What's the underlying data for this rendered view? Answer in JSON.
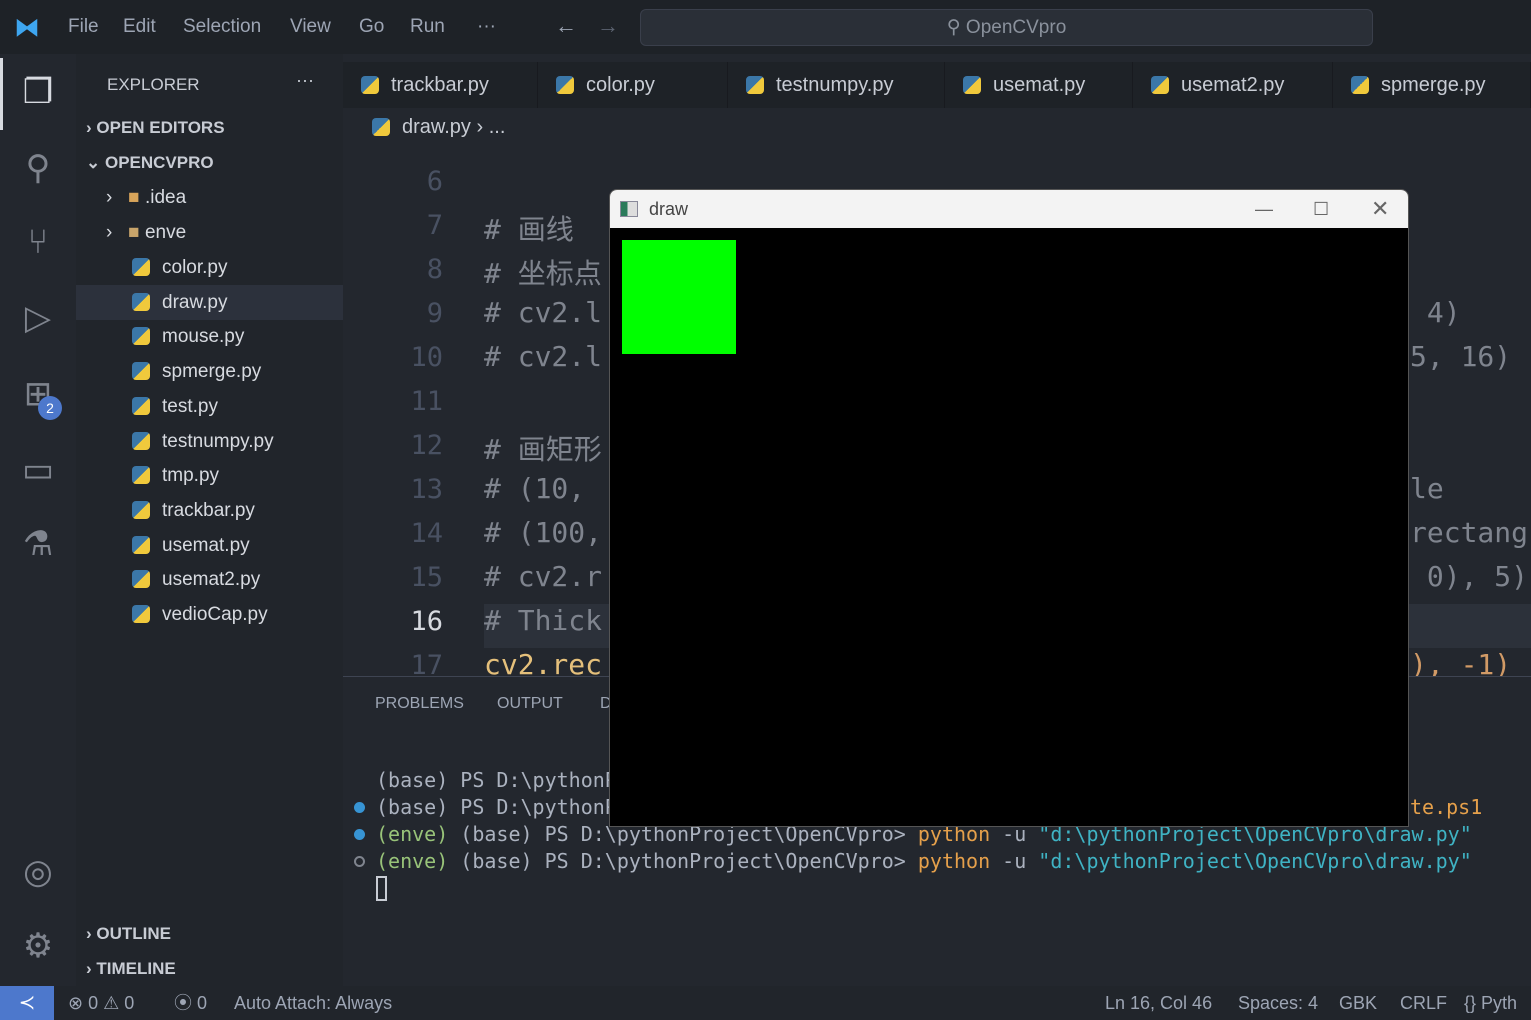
{
  "titlebar": {
    "menu": [
      "File",
      "Edit",
      "Selection",
      "View",
      "Go",
      "Run",
      "···"
    ],
    "search": "OpenCVpro"
  },
  "activity": {
    "extensions_badge": "2"
  },
  "sidebar": {
    "header": "EXPLORER",
    "more": "···",
    "open_editors": "OPEN EDITORS",
    "project": "OPENCVPRO",
    "folders": [
      ".idea",
      "enve"
    ],
    "files": [
      "color.py",
      "draw.py",
      "mouse.py",
      "spmerge.py",
      "test.py",
      "testnumpy.py",
      "tmp.py",
      "trackbar.py",
      "usemat.py",
      "usemat2.py",
      "vedioCap.py"
    ],
    "selected": "draw.py",
    "outline": "OUTLINE",
    "timeline": "TIMELINE"
  },
  "tabs": [
    "trackbar.py",
    "color.py",
    "testnumpy.py",
    "usemat.py",
    "usemat2.py",
    "spmerge.py"
  ],
  "breadcrumb": {
    "file": "draw.py",
    "rest": "..."
  },
  "editor": {
    "lines": [
      {
        "n": "6",
        "left": "",
        "right": ""
      },
      {
        "n": "7",
        "left": "# 画线",
        "right": ""
      },
      {
        "n": "8",
        "left": "# 坐标点",
        "right": ""
      },
      {
        "n": "9",
        "left": "# cv2.l",
        "right": " 4)"
      },
      {
        "n": "10",
        "left": "# cv2.l",
        "right": "5, 16)"
      },
      {
        "n": "11",
        "left": "",
        "right": ""
      },
      {
        "n": "12",
        "left": "# 画矩形",
        "right": ""
      },
      {
        "n": "13",
        "left": "# (10,",
        "right": "le"
      },
      {
        "n": "14",
        "left": "# (100,",
        "right": "rectang"
      },
      {
        "n": "15",
        "left": "# cv2.r",
        "right": " 0), 5)"
      },
      {
        "n": "16",
        "left": "# Thick",
        "right": ""
      },
      {
        "n": "17",
        "left": "cv2.rec",
        "right": "), -1)"
      }
    ],
    "current_line": "16"
  },
  "panel": {
    "tabs": [
      "PROBLEMS",
      "OUTPUT",
      "D"
    ],
    "terminal": [
      {
        "prefix": "",
        "text": "(base) PS D:\\pythonP",
        "tail": ""
      },
      {
        "prefix": "",
        "text": "(base) PS D:\\pythonP",
        "tail": "te.ps1"
      },
      {
        "prefix": "(enve)",
        "text": " (base) PS D:\\pythonProject\\OpenCVpro> ",
        "cmd": "python",
        "args": " -u ",
        "str": "\"d:\\pythonProject\\OpenCVpro\\draw.py\""
      },
      {
        "prefix": "(enve)",
        "text": " (base) PS D:\\pythonProject\\OpenCVpro> ",
        "cmd": "python",
        "args": " -u ",
        "str": "\"d:\\pythonProject\\OpenCVpro\\draw.py\""
      }
    ]
  },
  "dialog": {
    "title": "draw",
    "rect_color": "#00ff00"
  },
  "status": {
    "errors": "0",
    "warnings": "0",
    "ports": "0",
    "auto_attach": "Auto Attach: Always",
    "position": "Ln 16, Col 46",
    "spaces": "Spaces: 4",
    "encoding": "GBK",
    "eol": "CRLF",
    "language": "Pyth"
  }
}
